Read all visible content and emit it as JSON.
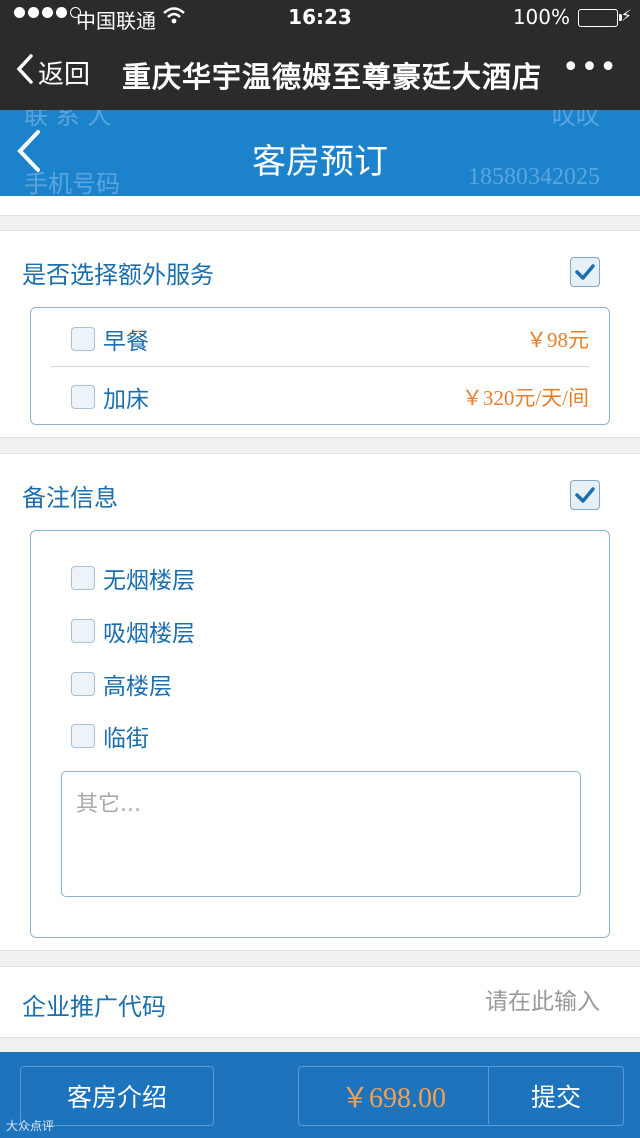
{
  "status_bar": {
    "carrier": "中国联通",
    "time": "16:23",
    "battery": "100%",
    "wifi_icon": "wifi-icon",
    "battery_level": 1.0
  },
  "wechat_bar": {
    "back_label": "返回",
    "title": "重庆华宇温德姆至尊豪廷大酒店",
    "more_icon": "more-icon"
  },
  "app_header": {
    "title": "客房预订",
    "ghost_contact_label": "联 系 人",
    "ghost_contact_value": "叹叹",
    "ghost_phone_label": "手机号码",
    "ghost_phone_value": "18580342025"
  },
  "extra_services": {
    "title": "是否选择额外服务",
    "checked": true,
    "items": [
      {
        "label": "早餐",
        "price": "￥98元",
        "checked": false
      },
      {
        "label": "加床",
        "price": "￥320元/天/间",
        "checked": false
      }
    ]
  },
  "remarks": {
    "title": "备注信息",
    "checked": true,
    "options": [
      {
        "label": "无烟楼层",
        "checked": false
      },
      {
        "label": "吸烟楼层",
        "checked": false
      },
      {
        "label": "高楼层",
        "checked": false
      },
      {
        "label": "临街",
        "checked": false
      }
    ],
    "other_placeholder": "其它..."
  },
  "promo": {
    "label": "企业推广代码",
    "placeholder": "请在此输入"
  },
  "footer": {
    "intro_label": "客房介绍",
    "total_price": "￥698.00",
    "submit_label": "提交",
    "watermark": "大众点评"
  },
  "colors": {
    "header_blue": "#1d82cc",
    "footer_blue": "#1d74bd",
    "price_orange": "#e67f2d",
    "text_blue": "#1b6fae"
  }
}
